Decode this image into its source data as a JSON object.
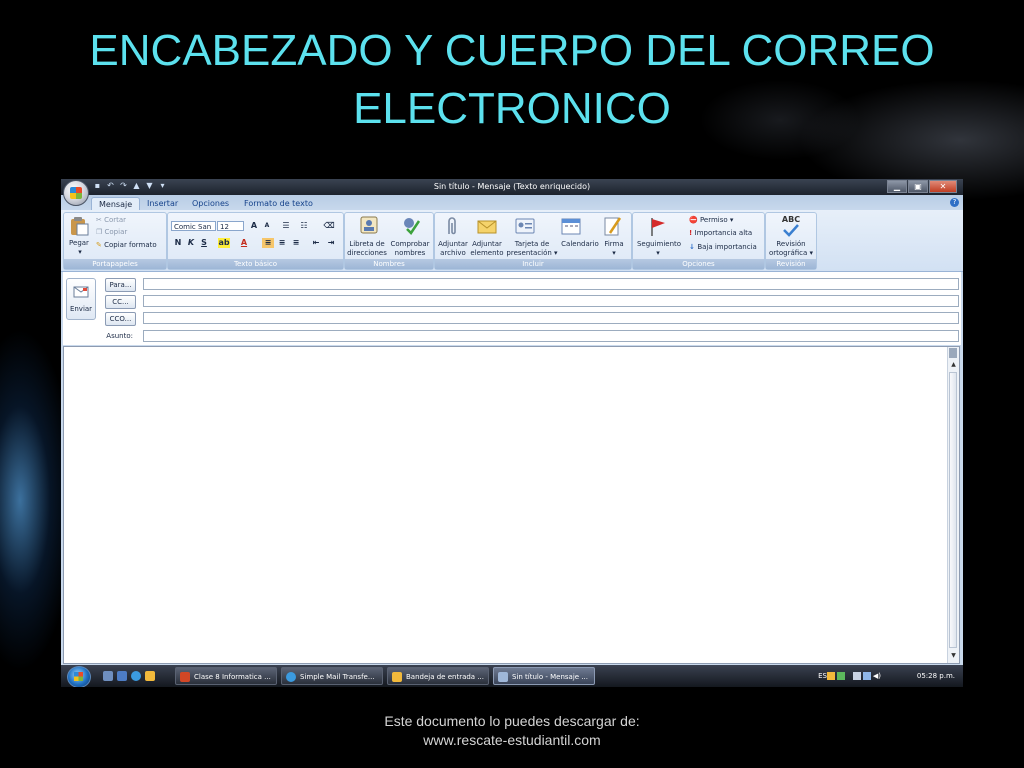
{
  "slide": {
    "title_line1": "ENCABEZADO Y CUERPO DEL CORREO",
    "title_line2": "ELECTRONICO",
    "footer_line1": "Este documento lo puedes descargar de:",
    "footer_line2": "www.rescate-estudiantil.com"
  },
  "window": {
    "title": "Sin título - Mensaje (Texto enriquecido)",
    "quick_access_icons": [
      "save-icon",
      "undo-icon",
      "redo-icon",
      "up-arrow-icon",
      "down-arrow-icon",
      "customize-icon"
    ],
    "controls": {
      "minimize": "▁",
      "maximize": "▣",
      "close": "✕"
    }
  },
  "tabs": [
    "Mensaje",
    "Insertar",
    "Opciones",
    "Formato de texto"
  ],
  "active_tab": "Mensaje",
  "ribbon": {
    "portapapeles": {
      "label": "Portapapeles",
      "pegar": "Pegar",
      "cortar": "Cortar",
      "copiar": "Copiar",
      "copiar_formato": "Copiar formato"
    },
    "texto_basico": {
      "label": "Texto básico",
      "font": "Comic San",
      "size": "12",
      "bold": "N",
      "italic": "K",
      "underline": "S"
    },
    "nombres": {
      "label": "Nombres",
      "libreta_1": "Libreta de",
      "libreta_2": "direcciones",
      "comprobar_1": "Comprobar",
      "comprobar_2": "nombres"
    },
    "incluir": {
      "label": "Incluir",
      "adjuntar_archivo_1": "Adjuntar",
      "adjuntar_archivo_2": "archivo",
      "adjuntar_elemento_1": "Adjuntar",
      "adjuntar_elemento_2": "elemento",
      "tarjeta_1": "Tarjeta de",
      "tarjeta_2": "presentación ▾",
      "calendario": "Calendario",
      "firma": "Firma"
    },
    "opciones": {
      "label": "Opciones",
      "seguimiento": "Seguimiento",
      "permiso": "Permiso ▾",
      "importancia_alta": "Importancia alta",
      "baja_importancia": "Baja importancia"
    },
    "revision": {
      "label": "Revisión",
      "revision_1": "Revisión",
      "revision_2": "ortográfica ▾",
      "abc": "ABC"
    }
  },
  "header": {
    "send": "Enviar",
    "to": "Para...",
    "cc": "CC...",
    "bcc": "CCO...",
    "subject_label": "Asunto:",
    "to_value": "",
    "cc_value": "",
    "bcc_value": "",
    "subject_value": ""
  },
  "taskbar": {
    "items": [
      "Clase 8 Informatica ...",
      "Simple Mail Transfe...",
      "Bandeja de entrada ...",
      "Sin título - Mensaje ..."
    ],
    "language": "ES",
    "time": "05:28 p.m."
  }
}
